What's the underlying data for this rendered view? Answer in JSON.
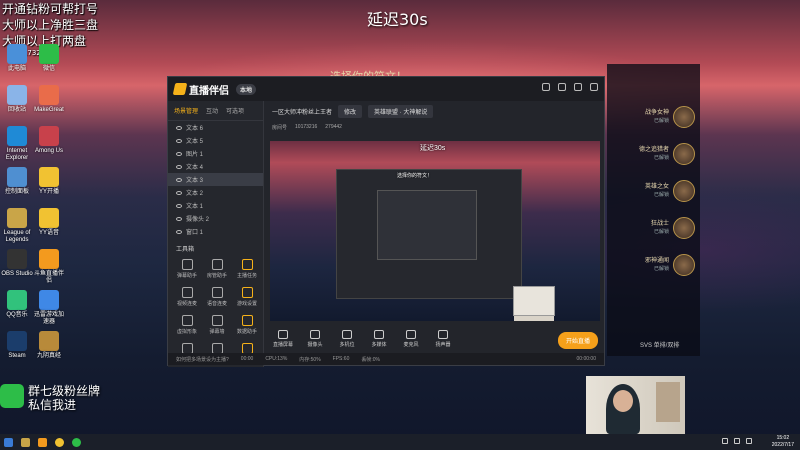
{
  "overlay": {
    "line1": "开通钻粉可帮打号",
    "line2": "大师以上净胜三盘",
    "line3": "大师以上打两盘",
    "room_id": "10173216",
    "delay": "延迟30s"
  },
  "desktop_icons": [
    {
      "label": "此电脑",
      "color": "#4a90d9"
    },
    {
      "label": "微信",
      "color": "#2dbd48"
    },
    {
      "label": "回收站",
      "color": "#8ab4e8"
    },
    {
      "label": "MakeGreat",
      "color": "#e96c4a"
    },
    {
      "label": "Internet Explorer",
      "color": "#1f8ad6"
    },
    {
      "label": "Among Us",
      "color": "#c8414b"
    },
    {
      "label": "控制面板",
      "color": "#4f8fd1"
    },
    {
      "label": "YY开播",
      "color": "#f1c232"
    },
    {
      "label": "League of Legends",
      "color": "#c9a548"
    },
    {
      "label": "YY语音",
      "color": "#f1c232"
    },
    {
      "label": "OBS Studio",
      "color": "#333333"
    },
    {
      "label": "斗鱼直播伴侣",
      "color": "#f39a1e"
    },
    {
      "label": "QQ音乐",
      "color": "#31c27c"
    },
    {
      "label": "迅雷游戏加速器",
      "color": "#3f88e6"
    },
    {
      "label": "Steam",
      "color": "#1b3d6b"
    },
    {
      "label": "九阴真经",
      "color": "#b88a3a"
    }
  ],
  "app": {
    "brand": "直播伴侣",
    "badge": "本地",
    "left_tabs": [
      "场景管理",
      "互动",
      "可选项"
    ],
    "sources": [
      "文本 6",
      "文本 5",
      "图片 1",
      "文本 4",
      "文本 3",
      "文本 2",
      "文本 1",
      "摄像头 2",
      "窗口 1"
    ],
    "tools_title": "工具箱",
    "tools": [
      "弹幕助手",
      "房管助手",
      "主播任务",
      "视频连麦",
      "语音连麦",
      "游戏设置",
      "虚拟形象",
      "弹幕墙",
      "数据助手",
      "动画特效",
      "更多",
      "小工具"
    ],
    "room_title": "一区大师冲粉丝上王者",
    "edit_label": "修改",
    "category": "英雄联盟 · 大神解说",
    "room_label": "房间号",
    "room_number": "10173216",
    "fans_count": "279442",
    "preview_label": "延迟30s",
    "preview_title": "选择你的符文！",
    "controls": [
      "直播屏幕",
      "摄像头",
      "多机位",
      "多媒体",
      "麦克风",
      "扬声器"
    ],
    "go_live": "开始直播",
    "status": [
      "如何把多场景设为主播?",
      "00:00",
      "CPU:13%",
      "内存:50%",
      "FPS:60",
      "丢帧:0%"
    ],
    "time": "00:00:00"
  },
  "right_panel": {
    "title": "选择你的符文！",
    "champions": [
      {
        "name": "战争女神",
        "sub": "已解锁"
      },
      {
        "name": "德之追猎者",
        "sub": "已解锁"
      },
      {
        "name": "英雄之女",
        "sub": "已解锁"
      },
      {
        "name": "狂战士",
        "sub": "已解锁"
      },
      {
        "name": "邪神通闻",
        "sub": "已解锁"
      }
    ],
    "bottom": "SVS 单排/双排"
  },
  "wechat": {
    "line1": "群七级粉丝牌",
    "line2": "私信我进"
  },
  "taskbar": {
    "time": "15:02",
    "date": "2022/7/17"
  }
}
